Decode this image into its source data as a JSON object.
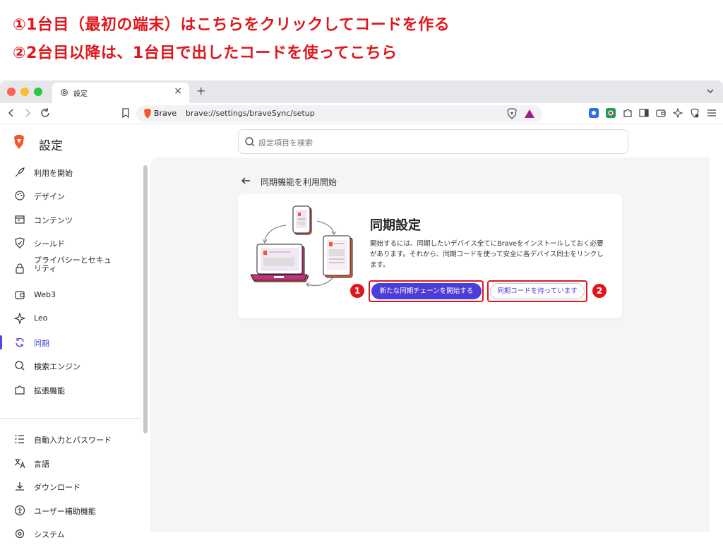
{
  "annotations": {
    "line1": "①1台目（最初の端末）はこちらをクリックしてコードを作る",
    "line2": "②2台目以降は、1台目で出したコードを使ってこちら"
  },
  "browser": {
    "tab_title": "設定",
    "tab_close": "×",
    "new_tab": "+",
    "omnibox_brand": "Brave",
    "url": "brave://settings/braveSync/setup"
  },
  "settings": {
    "page_title": "設定",
    "search_placeholder": "設定項目を検索",
    "sidebar": {
      "items": [
        {
          "label": "利用を開始",
          "icon": "rocket-icon"
        },
        {
          "label": "デザイン",
          "icon": "palette-icon"
        },
        {
          "label": "コンテンツ",
          "icon": "content-icon"
        },
        {
          "label": "シールド",
          "icon": "shield-check-icon"
        },
        {
          "label": "プライバシーとセキュリティ",
          "icon": "lock-icon"
        },
        {
          "label": "Web3",
          "icon": "wallet-icon"
        },
        {
          "label": "Leo",
          "icon": "sparkle-icon"
        },
        {
          "label": "同期",
          "icon": "sync-icon",
          "active": true
        },
        {
          "label": "検索エンジン",
          "icon": "search-icon"
        },
        {
          "label": "拡張機能",
          "icon": "puzzle-icon"
        },
        {
          "label": "自動入力とパスワード",
          "icon": "list-icon"
        },
        {
          "label": "言語",
          "icon": "translate-icon"
        },
        {
          "label": "ダウンロード",
          "icon": "download-icon"
        },
        {
          "label": "ユーザー補助機能",
          "icon": "accessibility-icon"
        },
        {
          "label": "システム",
          "icon": "gear-icon"
        }
      ]
    }
  },
  "sync": {
    "section_title": "同期機能を利用開始",
    "card_title": "同期設定",
    "description": "開始するには、同期したいデバイス全てにBraveをインストールしておく必要があります。それから、同期コードを使って安全に各デバイス同士をリンクします。",
    "primary_button": "新たな同期チェーンを開始する",
    "secondary_button": "同期コードを持っています",
    "marker1": "1",
    "marker2": "2"
  },
  "colors": {
    "accent": "#4c3dd6",
    "annotation_red": "#e0161b",
    "brave_orange": "#fb542b"
  }
}
